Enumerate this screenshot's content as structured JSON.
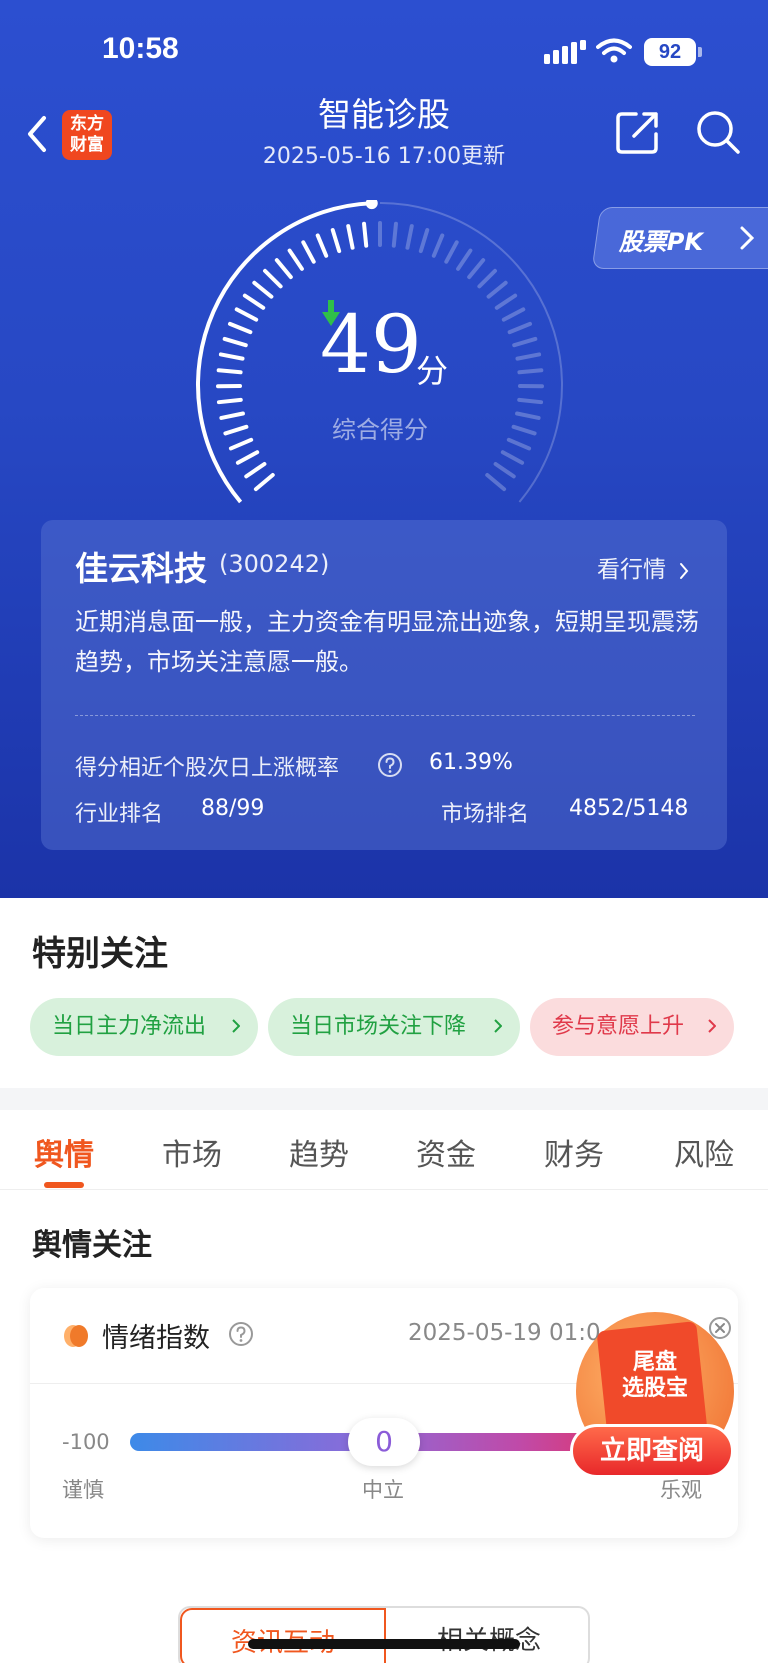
{
  "status_bar": {
    "time": "10:58",
    "battery": "92"
  },
  "nav": {
    "logo_line1": "东方",
    "logo_line2": "财富",
    "title": "智能诊股",
    "subtitle": "2025-05-16 17:00更新"
  },
  "pk_button": {
    "label": "股票PK"
  },
  "gauge": {
    "score": "49",
    "unit": "分",
    "label": "综合得分",
    "score_value": 49,
    "score_max": 100,
    "trend": "down"
  },
  "stock": {
    "name": "佳云科技",
    "code": "(300242)",
    "market_link": "看行情",
    "summary": "近期消息面一般，主力资金有明显流出迹象，短期呈现震荡趋势，市场关注意愿一般。",
    "prob_label": "得分相近个股次日上涨概率",
    "prob_value": "61.39%",
    "industry_label": "行业排名",
    "industry_value": "88/99",
    "market_label": "市场排名",
    "market_value": "4852/5148"
  },
  "attention": {
    "title": "特别关注",
    "chips": [
      {
        "label": "当日主力净流出",
        "color": "green"
      },
      {
        "label": "当日市场关注下降",
        "color": "green"
      },
      {
        "label": "参与意愿上升",
        "color": "red"
      }
    ]
  },
  "tabs": [
    {
      "label": "舆情",
      "active": true
    },
    {
      "label": "市场",
      "active": false
    },
    {
      "label": "趋势",
      "active": false
    },
    {
      "label": "资金",
      "active": false
    },
    {
      "label": "财务",
      "active": false
    },
    {
      "label": "风险",
      "active": false
    }
  ],
  "section_title": "舆情关注",
  "emotion": {
    "title": "情绪指数",
    "date": "2025-05-19 01:0",
    "min_label": "-100",
    "value": "0",
    "left_label": "谨慎",
    "mid_label": "中立",
    "right_label": "乐观"
  },
  "promo": {
    "text_line1": "尾盘",
    "text_line2": "选股宝",
    "button": "立即查阅"
  },
  "bottom_tabs": {
    "left": "资讯互动",
    "right": "相关概念"
  },
  "colors": {
    "accent": "#f0571f",
    "hero": "#2748c4",
    "up_green": "#21a142",
    "down_red": "#e0394a"
  }
}
